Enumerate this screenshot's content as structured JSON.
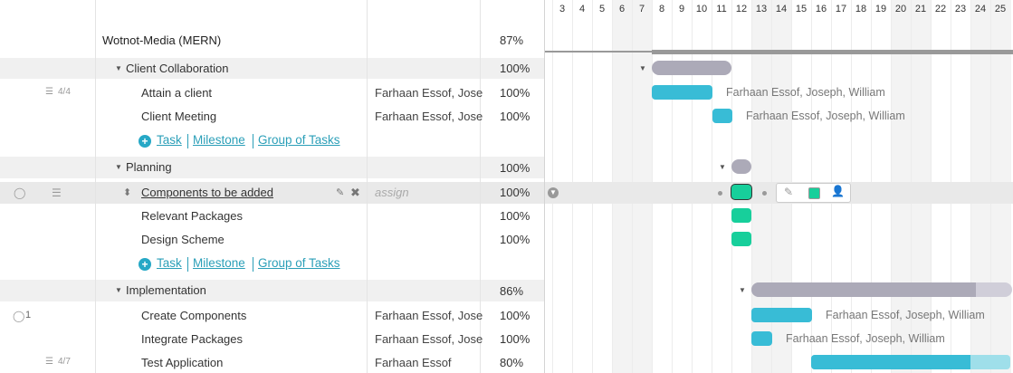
{
  "project": {
    "name": "Wotnot-Media (MERN)",
    "percent": "87%"
  },
  "rows": [
    {
      "type": "group",
      "name": "Client Collaboration",
      "percent": "100%"
    },
    {
      "type": "task",
      "name": "Attain a client",
      "assign": "Farhaan Essof, Jose",
      "percent": "100%",
      "checklist": "4/4",
      "gantt_label": "Farhaan Essof, Joseph, William"
    },
    {
      "type": "task",
      "name": "Client Meeting",
      "assign": "Farhaan Essof, Jose",
      "percent": "100%",
      "gantt_label": "Farhaan Essof, Joseph, William"
    },
    {
      "type": "group",
      "name": "Planning",
      "percent": "100%"
    },
    {
      "type": "task",
      "name": "Components to be added",
      "assign": "assign",
      "percent": "100%"
    },
    {
      "type": "task",
      "name": "Relevant Packages",
      "percent": "100%"
    },
    {
      "type": "task",
      "name": "Design Scheme",
      "percent": "100%"
    },
    {
      "type": "group",
      "name": "Implementation",
      "percent": "86%"
    },
    {
      "type": "task",
      "name": "Create Components",
      "assign": "Farhaan Essof, Jose",
      "percent": "100%",
      "comments": "1",
      "gantt_label": "Farhaan Essof, Joseph, William"
    },
    {
      "type": "task",
      "name": "Integrate Packages",
      "assign": "Farhaan Essof, Jose",
      "percent": "100%",
      "gantt_label": "Farhaan Essof, Joseph, William"
    },
    {
      "type": "task",
      "name": "Test Application",
      "assign": "Farhaan Essof",
      "percent": "80%",
      "checklist": "4/7"
    }
  ],
  "add_links": {
    "task": "Task",
    "milestone": "Milestone",
    "group": "Group of Tasks"
  },
  "days": [
    "3",
    "4",
    "5",
    "6",
    "7",
    "8",
    "9",
    "10",
    "11",
    "12",
    "13",
    "14",
    "15",
    "16",
    "17",
    "18",
    "19",
    "20",
    "21",
    "22",
    "23",
    "24",
    "25"
  ],
  "colors": {
    "accent": "#2b9fb8",
    "task_bar": "#38bcd6",
    "milestone_bar": "#17cf9b",
    "group_bar": "#acaab8"
  }
}
